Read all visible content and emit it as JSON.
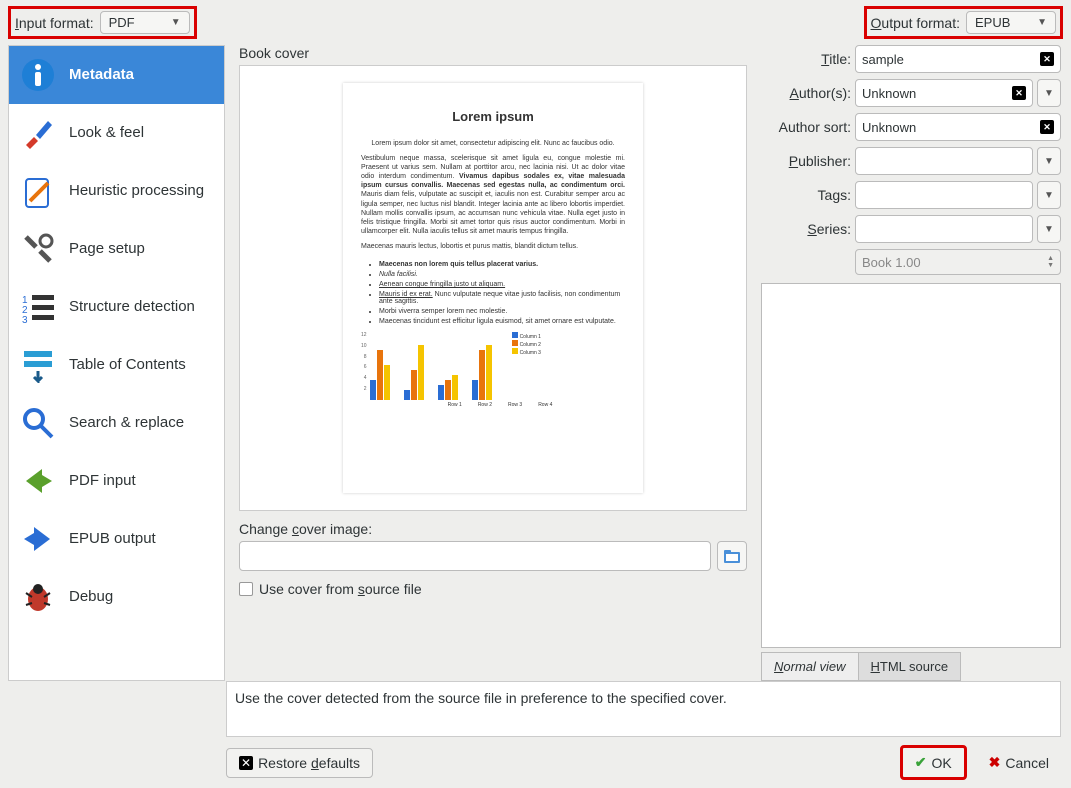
{
  "top": {
    "input_label_pre": "I",
    "input_label": "nput format:",
    "input_value": "PDF",
    "output_label_pre": "O",
    "output_label": "utput format:",
    "output_value": "EPUB"
  },
  "sidebar": {
    "items": [
      {
        "label": "Metadata"
      },
      {
        "label": "Look & feel"
      },
      {
        "label": "Heuristic processing"
      },
      {
        "label": "Page setup"
      },
      {
        "label": "Structure detection"
      },
      {
        "label": "Table of Contents"
      },
      {
        "label": "Search & replace"
      },
      {
        "label": "PDF input"
      },
      {
        "label": "EPUB output"
      },
      {
        "label": "Debug"
      }
    ]
  },
  "center": {
    "cover_label": "Book cover",
    "cover": {
      "title": "Lorem ipsum",
      "p1": "Lorem ipsum dolor sit amet, consectetur adipiscing elit. Nunc ac faucibus odio.",
      "p2a": "Vestibulum neque massa, scelerisque sit amet ligula eu, congue molestie mi. Praesent ut varius sem. Nullam at porttitor arcu, nec lacinia nisi. Ut ac dolor vitae odio interdum condimentum. ",
      "p2b": "Vivamus dapibus sodales ex, vitae malesuada ipsum cursus convallis. Maecenas sed egestas nulla, ac condimentum orci.",
      "p2c": " Mauris diam felis, vulputate ac suscipit et, iaculis non est. Curabitur semper arcu ac ligula semper, nec luctus nisl blandit. Integer lacinia ante ac libero lobortis imperdiet. Nullam mollis convallis ipsum, ac accumsan nunc vehicula vitae. Nulla eget justo in felis tristique fringilla. Morbi sit amet tortor quis risus auctor condimentum. Morbi in ullamcorper elit. Nulla iaculis tellus sit amet mauris tempus fringilla.",
      "p3": "Maecenas mauris lectus, lobortis et purus mattis, blandit dictum tellus.",
      "b1": "Maecenas non lorem quis tellus placerat varius.",
      "b2": "Nulla facilisi.",
      "b3": "Aenean congue fringilla justo ut aliquam.",
      "b4a": "Mauris id ex erat.",
      "b4b": " Nunc vulputate neque vitae justo facilisis, non condimentum ante sagittis.",
      "b5": "Morbi viverra semper lorem nec molestie.",
      "b6": "Maecenas tincidunt est efficitur ligula euismod, sit amet ornare est vulputate."
    },
    "change_label_pre": "Change ",
    "change_label_u": "c",
    "change_label_post": "over image:",
    "use_cover_pre": "Use cover from ",
    "use_cover_u": "s",
    "use_cover_post": "ource file"
  },
  "right": {
    "title_label_u": "T",
    "title_label": "itle:",
    "title_value": "sample",
    "author_label_u": "A",
    "author_label": "uthor(s):",
    "author_value": "Unknown",
    "sort_label": "Author sort:",
    "sort_value": "Unknown",
    "pub_label_u": "P",
    "pub_label": "ublisher:",
    "tags_label": "Tags:",
    "series_label_u": "S",
    "series_label": "eries:",
    "book_num": "Book 1.00",
    "tab_normal_u": "N",
    "tab_normal": "ormal view",
    "tab_html_u": "H",
    "tab_html": "TML source"
  },
  "desc": "Use the cover detected from the source file in preference to the specified cover.",
  "bottom": {
    "restore_pre": "Restore ",
    "restore_u": "d",
    "restore_post": "efaults",
    "ok": "OK",
    "cancel": "Cancel"
  },
  "chart_data": {
    "type": "bar",
    "categories": [
      "Row 1",
      "Row 2",
      "Row 3",
      "Row 4"
    ],
    "series": [
      {
        "name": "Column 1",
        "color": "#2a6dd4",
        "values": [
          4,
          2,
          3,
          4
        ]
      },
      {
        "name": "Column 2",
        "color": "#e8740c",
        "values": [
          10,
          6,
          4,
          10
        ]
      },
      {
        "name": "Column 3",
        "color": "#f5c400",
        "values": [
          7,
          11,
          5,
          11
        ]
      }
    ],
    "ylim": [
      0,
      12
    ],
    "yticks": [
      2,
      4,
      6,
      8,
      10,
      12
    ]
  }
}
